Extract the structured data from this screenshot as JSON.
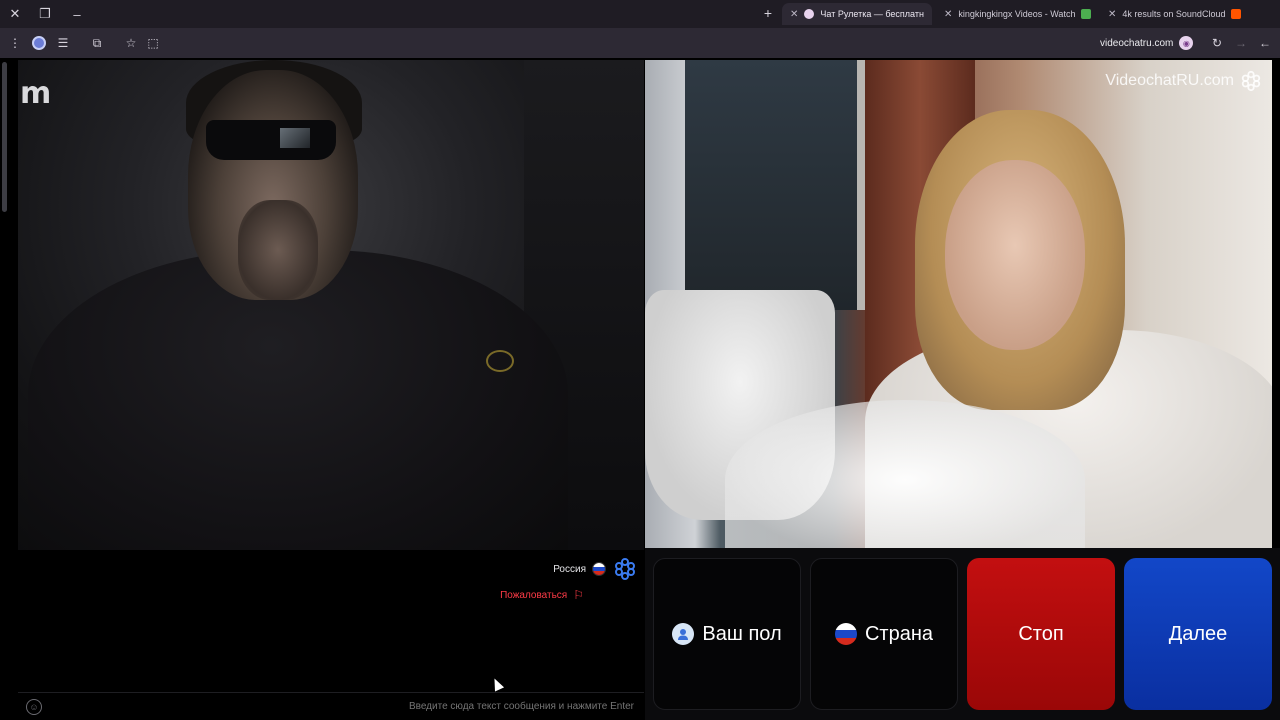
{
  "browser": {
    "tabs": [
      {
        "title": "4k results on SoundCloud",
        "favicon_color": "#ff5500"
      },
      {
        "title": "kingkingkingx Videos - Watch",
        "favicon_color": "#4caf50"
      },
      {
        "title": "Чат Рулетка — бесплатн",
        "favicon_color": "#e8d3ee"
      }
    ],
    "newtab_label": "+",
    "url": "videochatru.com",
    "window_controls": {
      "close": "✕",
      "restore": "❐",
      "minimize": "–"
    }
  },
  "page": {
    "logo_letter": "m",
    "partner": {
      "country": "Россия",
      "report_label": "Пожаловаться"
    },
    "chat": {
      "placeholder": "Введите сюда текст сообщения и нажмите Enter"
    },
    "watermark": "VideochatRU.com",
    "controls": {
      "gender_label": "Ваш пол",
      "country_label": "Страна",
      "stop_label": "Стоп",
      "next_label": "Далее"
    },
    "colors": {
      "stop": "#c30f10",
      "next": "#1247c8",
      "report": "#ff3b47"
    }
  }
}
